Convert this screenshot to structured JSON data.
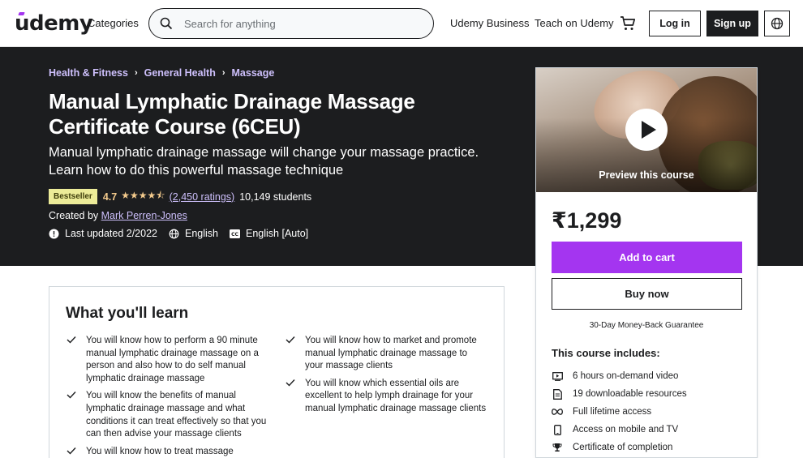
{
  "header": {
    "logo": "udemy",
    "categories": "Categories",
    "search_placeholder": "Search for anything",
    "udemy_business": "Udemy Business",
    "teach": "Teach on Udemy",
    "login": "Log in",
    "signup": "Sign up"
  },
  "breadcrumbs": [
    "Health & Fitness",
    "General Health",
    "Massage"
  ],
  "course": {
    "title": "Manual Lymphatic Drainage Massage Certificate Course (6CEU)",
    "subtitle": "Manual lymphatic drainage massage will change your massage practice. Learn how to do this powerful massage technique",
    "badge": "Bestseller",
    "rating": "4.7",
    "rating_stars": 4.5,
    "ratings_count": "(2,450 ratings)",
    "students": "10,149 students",
    "created_by_label": "Created by",
    "instructor": "Mark Perren-Jones",
    "last_updated": "Last updated 2/2022",
    "language": "English",
    "captions": "English [Auto]"
  },
  "sidebar": {
    "preview_label": "Preview this course",
    "price": "₹1,299",
    "add_to_cart": "Add to cart",
    "buy_now": "Buy now",
    "guarantee": "30-Day Money-Back Guarantee",
    "includes_title": "This course includes:",
    "includes": [
      {
        "icon": "video-icon",
        "label": "6 hours on-demand video"
      },
      {
        "icon": "file-icon",
        "label": "19 downloadable resources"
      },
      {
        "icon": "infinity-icon",
        "label": "Full lifetime access"
      },
      {
        "icon": "mobile-icon",
        "label": "Access on mobile and TV"
      },
      {
        "icon": "trophy-icon",
        "label": "Certificate of completion"
      }
    ]
  },
  "learn": {
    "title": "What you'll learn",
    "left": [
      "You will know how to perform a 90 minute manual lymphatic drainage massage on a person and also how to do self manual lymphatic drainage massage",
      "You will know the benefits of manual lymphatic drainage massage and what conditions it can treat effectively so that you can then advise your massage clients",
      "You will know how to treat massage"
    ],
    "right": [
      "You will know how to market and promote manual lymphatic drainage massage to your massage clients",
      "You will know which essential oils are excellent to help lymph drainage for your manual lymphatic drainage massage clients"
    ]
  },
  "colors": {
    "accent": "#a435f0",
    "dark": "#1c1d1f",
    "link_light": "#cec0fc",
    "star": "#f3ca8c",
    "badge_bg": "#eceb98"
  }
}
